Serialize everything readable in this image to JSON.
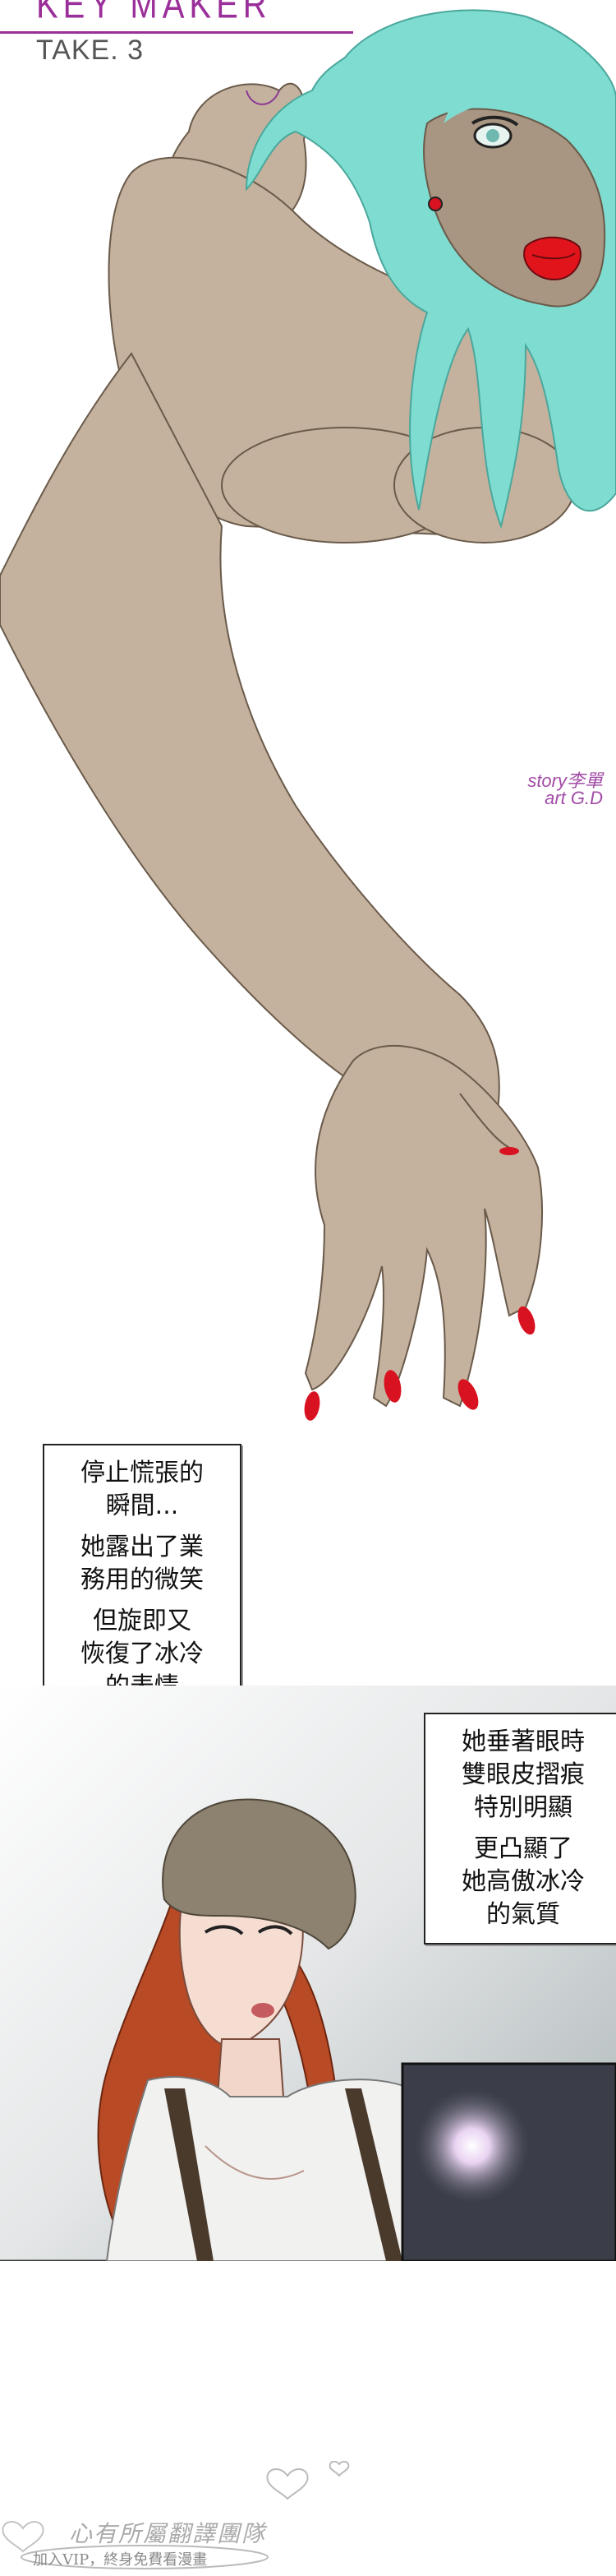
{
  "header": {
    "title_fragment": "KEY MAKER",
    "take_label": "TAKE. 3"
  },
  "credits": {
    "story": "story李單",
    "art": "art G.D"
  },
  "narration": [
    {
      "lines": [
        "停止慌張的\n瞬間...",
        "她露出了業\n務用的微笑",
        "但旋即又\n恢復了冰冷\n的表情"
      ]
    },
    {
      "lines": [
        "她垂著眼時\n雙眼皮摺痕\n特別明顯",
        "更凸顯了\n她高傲冰冷\n的氣質"
      ]
    }
  ],
  "watermark": {
    "group_name": "心有所屬翻譯團隊",
    "slogan": "加入VIP，終身免費看漫畫"
  },
  "colors": {
    "title": "#9b2f9a",
    "skin": "#c4b29e",
    "hair": "#7fdcd0",
    "lips": "#e2141b",
    "nails": "#d81220",
    "hat": "#8d8270"
  }
}
